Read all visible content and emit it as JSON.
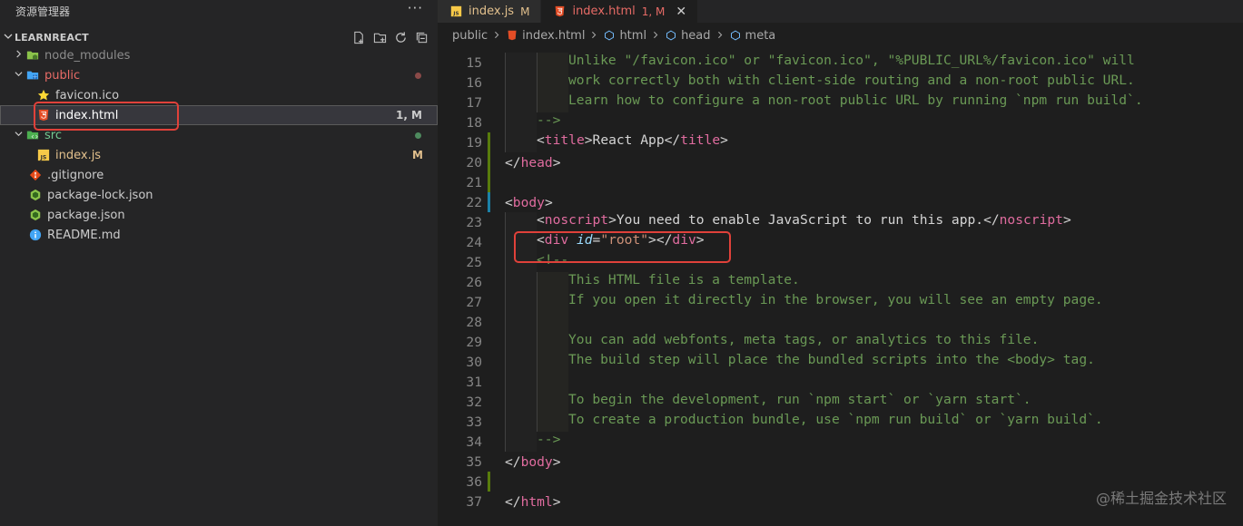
{
  "explorer": {
    "title": "资源管理器",
    "more": "···",
    "section": "LEARNREACT",
    "actions": [
      "new-file-icon",
      "new-folder-icon",
      "refresh-icon",
      "collapse-all-icon"
    ],
    "items": [
      {
        "label": "node_modules",
        "type": "folder",
        "expanded": false,
        "depth": 0,
        "status": "",
        "color": "dim"
      },
      {
        "label": "public",
        "type": "folder",
        "expanded": true,
        "depth": 0,
        "status": "dot",
        "color": "red"
      },
      {
        "label": "favicon.ico",
        "type": "file",
        "depth": 1,
        "status": "",
        "color": "normal"
      },
      {
        "label": "index.html",
        "type": "file",
        "depth": 1,
        "status": "1, M",
        "color": "white",
        "selected": true
      },
      {
        "label": "src",
        "type": "folder",
        "expanded": true,
        "depth": 0,
        "status": "dot",
        "color": "green"
      },
      {
        "label": "index.js",
        "type": "file",
        "depth": 1,
        "status": "M",
        "color": "mod"
      },
      {
        "label": ".gitignore",
        "type": "file",
        "depth": 0,
        "status": "",
        "color": "normal"
      },
      {
        "label": "package-lock.json",
        "type": "file",
        "depth": 0,
        "status": "",
        "color": "normal"
      },
      {
        "label": "package.json",
        "type": "file",
        "depth": 0,
        "status": "",
        "color": "normal"
      },
      {
        "label": "README.md",
        "type": "file",
        "depth": 0,
        "status": "",
        "color": "normal"
      }
    ]
  },
  "tabs": [
    {
      "label": "index.js",
      "status": "M",
      "active": false
    },
    {
      "label": "index.html",
      "status": "1, M",
      "active": true,
      "close": "✕"
    }
  ],
  "breadcrumb": [
    "public",
    "index.html",
    "html",
    "head",
    "meta"
  ],
  "code": {
    "lines": [
      {
        "n": "15",
        "ind": 2,
        "gut": "",
        "parts": [
          [
            "c",
            "Unlike \"/favicon.ico\" or \"favicon.ico\", \"%PUBLIC_URL%/favicon.ico\" will"
          ]
        ]
      },
      {
        "n": "16",
        "ind": 2,
        "gut": "",
        "parts": [
          [
            "c",
            "work correctly both with client-side routing and a non-root public URL."
          ]
        ]
      },
      {
        "n": "17",
        "ind": 2,
        "gut": "",
        "parts": [
          [
            "c",
            "Learn how to configure a non-root public URL by running `npm run build`."
          ]
        ]
      },
      {
        "n": "18",
        "ind": 1,
        "gut": "",
        "parts": [
          [
            "c",
            "-->"
          ]
        ]
      },
      {
        "n": "19",
        "ind": 1,
        "gut": "green",
        "parts": [
          [
            "b",
            "<"
          ],
          [
            "t",
            "title"
          ],
          [
            "b",
            ">"
          ],
          [
            "p",
            "React App"
          ],
          [
            "b",
            "</"
          ],
          [
            "t",
            "title"
          ],
          [
            "b",
            ">"
          ]
        ]
      },
      {
        "n": "20",
        "ind": 0,
        "gut": "green",
        "parts": [
          [
            "b",
            "</"
          ],
          [
            "t",
            "head"
          ],
          [
            "b",
            ">"
          ]
        ]
      },
      {
        "n": "21",
        "ind": 0,
        "gut": "green",
        "parts": []
      },
      {
        "n": "22",
        "ind": 0,
        "gut": "blue",
        "parts": [
          [
            "b",
            "<"
          ],
          [
            "t",
            "body"
          ],
          [
            "b",
            ">"
          ]
        ]
      },
      {
        "n": "23",
        "ind": 1,
        "gut": "",
        "parts": [
          [
            "b",
            "<"
          ],
          [
            "t",
            "noscript"
          ],
          [
            "b",
            ">"
          ],
          [
            "p",
            "You need to enable JavaScript to run this app."
          ],
          [
            "b",
            "</"
          ],
          [
            "t",
            "noscript"
          ],
          [
            "b",
            ">"
          ]
        ]
      },
      {
        "n": "24",
        "ind": 1,
        "gut": "",
        "parts": [
          [
            "b",
            "<"
          ],
          [
            "t",
            "div"
          ],
          [
            "p",
            " "
          ],
          [
            "a",
            "id"
          ],
          [
            "p",
            "="
          ],
          [
            "s",
            "\"root\""
          ],
          [
            "b",
            "></"
          ],
          [
            "t",
            "div"
          ],
          [
            "b",
            ">"
          ]
        ]
      },
      {
        "n": "25",
        "ind": 1,
        "gut": "",
        "parts": [
          [
            "c",
            "<!--"
          ]
        ]
      },
      {
        "n": "26",
        "ind": 2,
        "gut": "",
        "parts": [
          [
            "c",
            "This HTML file is a template."
          ]
        ]
      },
      {
        "n": "27",
        "ind": 2,
        "gut": "",
        "parts": [
          [
            "c",
            "If you open it directly in the browser, you will see an empty page."
          ]
        ]
      },
      {
        "n": "28",
        "ind": 2,
        "gut": "",
        "parts": []
      },
      {
        "n": "29",
        "ind": 2,
        "gut": "",
        "parts": [
          [
            "c",
            "You can add webfonts, meta tags, or analytics to this file."
          ]
        ]
      },
      {
        "n": "30",
        "ind": 2,
        "gut": "",
        "parts": [
          [
            "c",
            "The build step will place the bundled scripts into the <body> tag."
          ]
        ]
      },
      {
        "n": "31",
        "ind": 2,
        "gut": "",
        "parts": []
      },
      {
        "n": "32",
        "ind": 2,
        "gut": "",
        "parts": [
          [
            "c",
            "To begin the development, run `npm start` or `yarn start`."
          ]
        ]
      },
      {
        "n": "33",
        "ind": 2,
        "gut": "",
        "parts": [
          [
            "c",
            "To create a production bundle, use `npm run build` or `yarn build`."
          ]
        ]
      },
      {
        "n": "34",
        "ind": 1,
        "gut": "",
        "parts": [
          [
            "c",
            "-->"
          ]
        ]
      },
      {
        "n": "35",
        "ind": 0,
        "gut": "",
        "parts": [
          [
            "b",
            "</"
          ],
          [
            "t",
            "body"
          ],
          [
            "b",
            ">"
          ]
        ]
      },
      {
        "n": "36",
        "ind": 0,
        "gut": "green",
        "parts": []
      },
      {
        "n": "37",
        "ind": 0,
        "gut": "",
        "parts": [
          [
            "b",
            "</"
          ],
          [
            "t",
            "html"
          ],
          [
            "b",
            ">"
          ]
        ]
      }
    ]
  },
  "watermark": "@稀土掘金技术社区",
  "colors": {
    "accent_red": "#e0413a",
    "modified": "#e2c08d",
    "error": "#e76b66",
    "added": "#73c991"
  }
}
